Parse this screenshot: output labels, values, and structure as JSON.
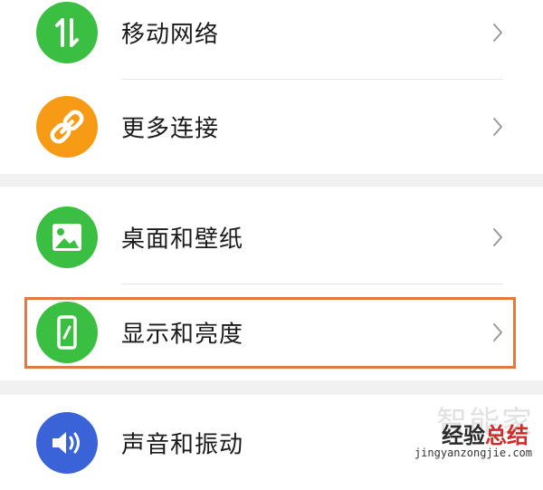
{
  "settings": {
    "items": [
      {
        "label": "移动网络",
        "icon": "mobile-data-icon",
        "color": "#3bbf43"
      },
      {
        "label": "更多连接",
        "icon": "link-icon",
        "color": "#f79a16"
      },
      {
        "label": "桌面和壁纸",
        "icon": "picture-icon",
        "color": "#3bbf43"
      },
      {
        "label": "显示和亮度",
        "icon": "phone-brightness-icon",
        "color": "#3bbf43"
      },
      {
        "label": "声音和振动",
        "icon": "speaker-icon",
        "color": "#3a63d8"
      }
    ]
  },
  "watermark": {
    "top_text": "智能家",
    "main_text_1": "经验",
    "main_text_2": "总结",
    "url": "jingyanzongjie.com"
  },
  "colors": {
    "group_gap": "#f1f1f1",
    "highlight_border": "#e07a45"
  }
}
